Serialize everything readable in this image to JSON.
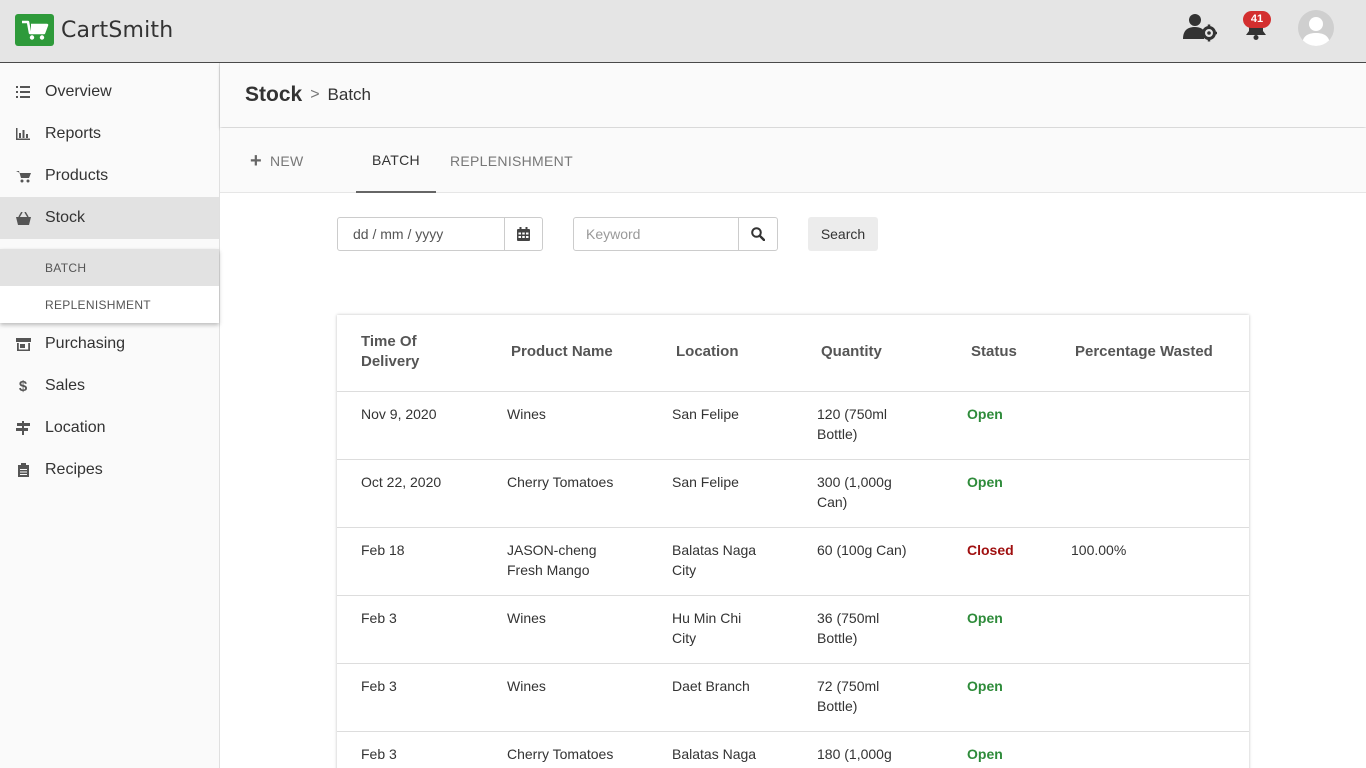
{
  "app": {
    "name": "CartSmith"
  },
  "topbar": {
    "notification_count": "41"
  },
  "sidebar": {
    "items": [
      {
        "label": "Overview",
        "icon": "list-icon"
      },
      {
        "label": "Reports",
        "icon": "bar-chart-icon"
      },
      {
        "label": "Products",
        "icon": "cart-icon"
      },
      {
        "label": "Stock",
        "icon": "basket-icon"
      },
      {
        "label": "Purchasing",
        "icon": "store-icon"
      },
      {
        "label": "Sales",
        "icon": "dollar-icon"
      },
      {
        "label": "Location",
        "icon": "signpost-icon"
      },
      {
        "label": "Recipes",
        "icon": "clipboard-icon"
      }
    ],
    "stock_submenu": [
      "BATCH",
      "REPLENISHMENT"
    ]
  },
  "breadcrumb": {
    "main": "Stock",
    "separator": ">",
    "sub": "Batch"
  },
  "tabs": {
    "new": "NEW",
    "batch": "BATCH",
    "replenishment": "REPLENISHMENT"
  },
  "filters": {
    "date_placeholder": "dd / mm / yyyy",
    "keyword_placeholder": "Keyword",
    "search_label": "Search"
  },
  "table": {
    "headers": {
      "time_line1": "Time Of",
      "time_line2": "Delivery",
      "product": "Product Name",
      "location": "Location",
      "quantity": "Quantity",
      "status": "Status",
      "wasted": "Percentage Wasted"
    },
    "rows": [
      {
        "time": "Nov 9, 2020",
        "product": [
          "Wines"
        ],
        "location": [
          "San Felipe"
        ],
        "quantity": [
          "120 (750ml",
          "Bottle)"
        ],
        "status": "Open",
        "wasted": ""
      },
      {
        "time": "Oct 22, 2020",
        "product": [
          "Cherry Tomatoes"
        ],
        "location": [
          "San Felipe"
        ],
        "quantity": [
          "300 (1,000g",
          "Can)"
        ],
        "status": "Open",
        "wasted": ""
      },
      {
        "time": "Feb 18",
        "product": [
          "JASON-cheng",
          "Fresh Mango"
        ],
        "location": [
          "Balatas Naga",
          "City"
        ],
        "quantity": [
          "60 (100g Can)"
        ],
        "status": "Closed",
        "wasted": "100.00%"
      },
      {
        "time": "Feb 3",
        "product": [
          "Wines"
        ],
        "location": [
          "Hu Min Chi",
          "City"
        ],
        "quantity": [
          "36 (750ml",
          "Bottle)"
        ],
        "status": "Open",
        "wasted": ""
      },
      {
        "time": "Feb 3",
        "product": [
          "Wines"
        ],
        "location": [
          "Daet Branch"
        ],
        "quantity": [
          "72 (750ml",
          "Bottle)"
        ],
        "status": "Open",
        "wasted": ""
      },
      {
        "time": "Feb 3",
        "product": [
          "Cherry Tomatoes"
        ],
        "location": [
          "Balatas Naga"
        ],
        "quantity": [
          "180 (1,000g"
        ],
        "status": "Open",
        "wasted": ""
      }
    ]
  },
  "colors": {
    "brand": "#2e9a3a",
    "status_open": "#2e8b3a",
    "status_closed": "#a01010",
    "badge": "#d32f2f"
  }
}
